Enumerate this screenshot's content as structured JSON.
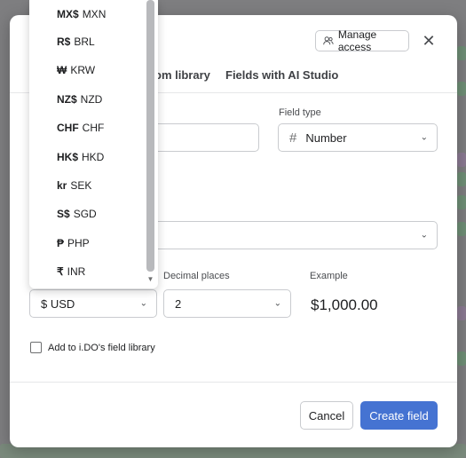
{
  "modal": {
    "manage_access_label": "Manage access",
    "tabs": [
      "om library",
      "Fields with AI Studio"
    ],
    "field_type_label": "Field type",
    "field_type_value": "Number",
    "decimal_places_label": "Decimal places",
    "decimal_places_value": "2",
    "example_label": "Example",
    "example_value": "$1,000.00",
    "currency_value": "$ USD",
    "library_checkbox_label": "Add to i.DO's field library",
    "cancel_label": "Cancel",
    "create_label": "Create field"
  },
  "currency_dropdown": {
    "items": [
      {
        "symbol": "MX$",
        "code": "MXN"
      },
      {
        "symbol": "R$",
        "code": "BRL"
      },
      {
        "symbol": "₩",
        "code": "KRW"
      },
      {
        "symbol": "NZ$",
        "code": "NZD"
      },
      {
        "symbol": "CHF",
        "code": "CHF"
      },
      {
        "symbol": "HK$",
        "code": "HKD"
      },
      {
        "symbol": "kr",
        "code": "SEK"
      },
      {
        "symbol": "S$",
        "code": "SGD"
      },
      {
        "symbol": "₱",
        "code": "PHP"
      },
      {
        "symbol": "₹",
        "code": "INR"
      }
    ]
  }
}
